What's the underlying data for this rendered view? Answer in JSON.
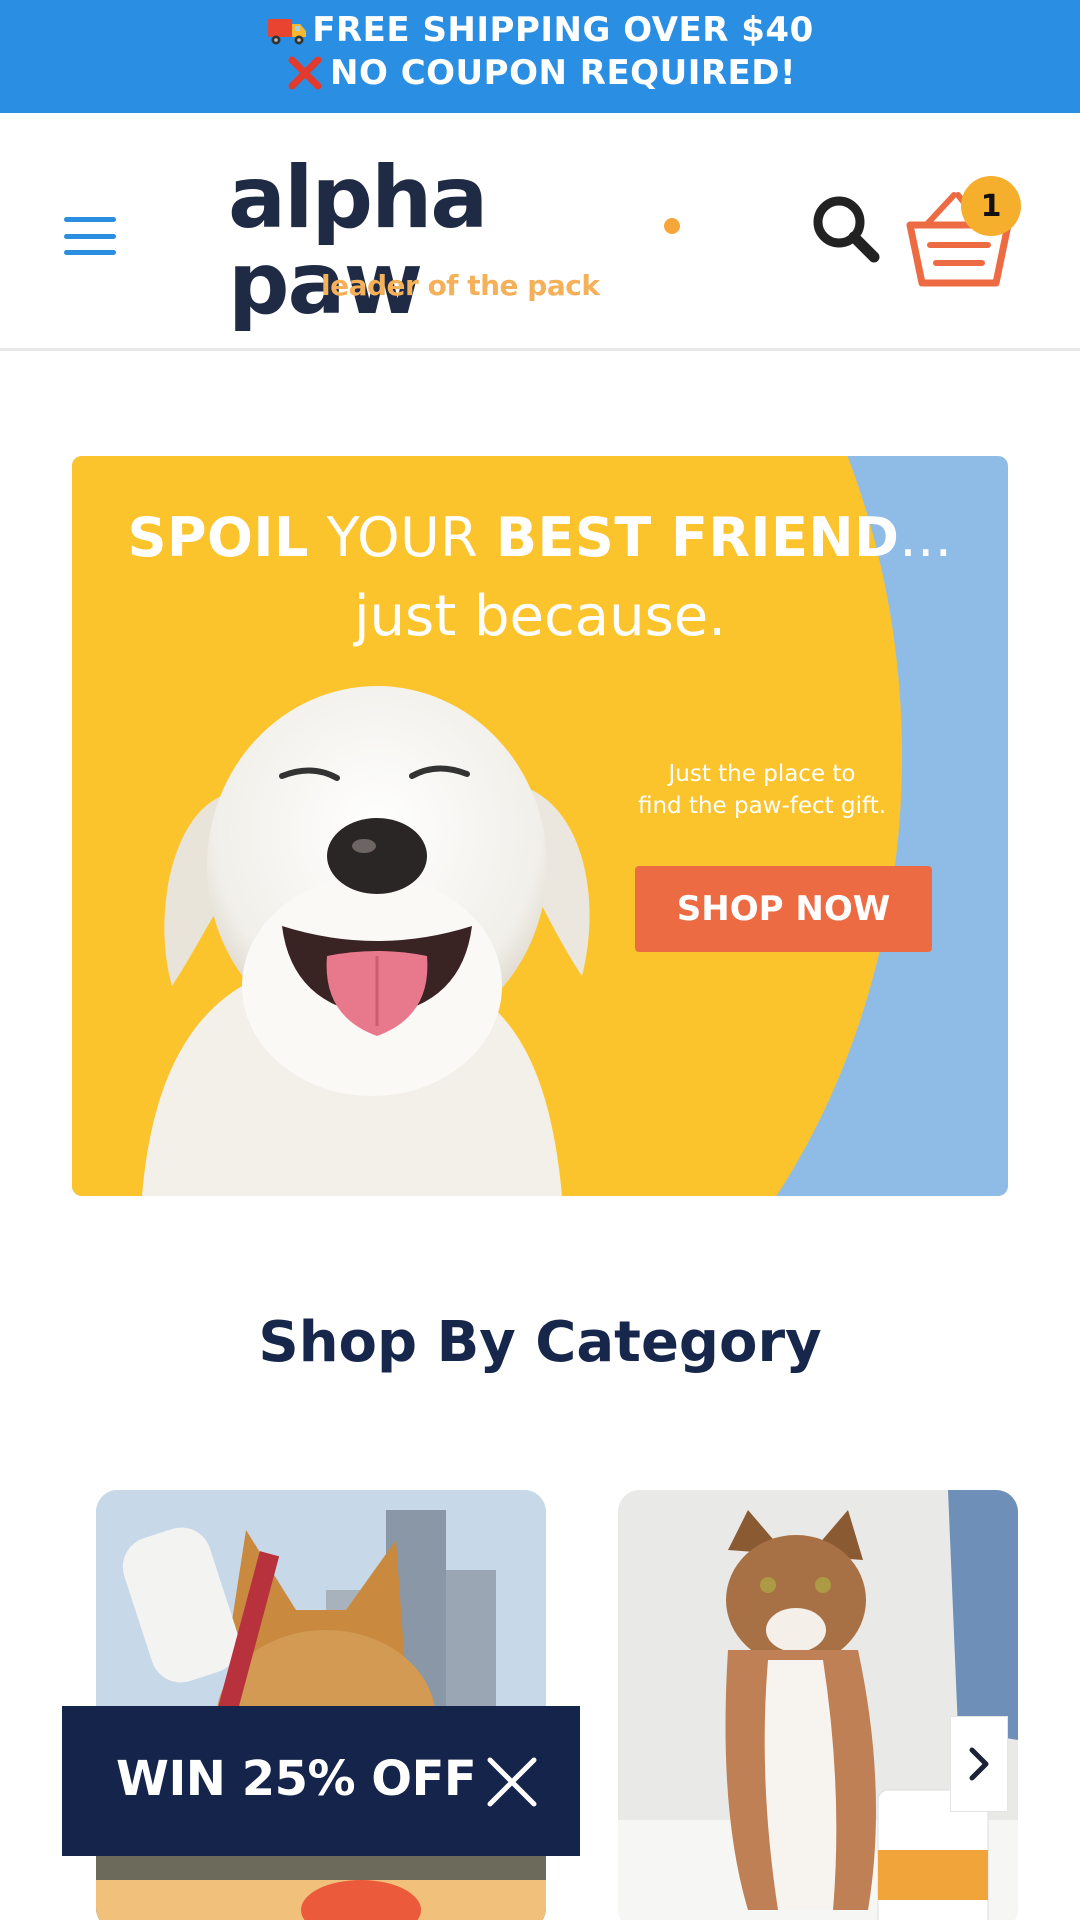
{
  "announcement": {
    "line1": "FREE SHIPPING OVER $40",
    "line2": "NO COUPON REQUIRED!",
    "icon1": "delivery-truck-emoji",
    "icon2": "cross-mark-emoji",
    "bg_color": "#2a8fe2"
  },
  "header": {
    "logo_text": "alpha paw",
    "logo_tagline": "leader of the pack",
    "cart_count": "1",
    "brand_navy": "#1f2a44",
    "brand_orange": "#f7a63a"
  },
  "hero": {
    "headline_bold1": "SPOIL",
    "headline_thin": "YOUR",
    "headline_bold2": "BEST FRIEND",
    "headline_ellipsis": "...",
    "subheadline": "just because.",
    "body_line1": "Just the place to",
    "body_line2": "find the paw-fect gift.",
    "cta_label": "SHOP NOW",
    "colors": {
      "yellow": "#fcc42c",
      "blue": "#8fbce6",
      "cta": "#ec6b43"
    }
  },
  "shop_by_category": {
    "title": "Shop By Category",
    "cards": [
      {
        "name": "dog",
        "image": "dog-category-photo"
      },
      {
        "name": "cat",
        "image": "cat-category-photo"
      }
    ]
  },
  "promo_popup": {
    "label": "WIN 25% OFF",
    "bg_color": "#14244a"
  }
}
